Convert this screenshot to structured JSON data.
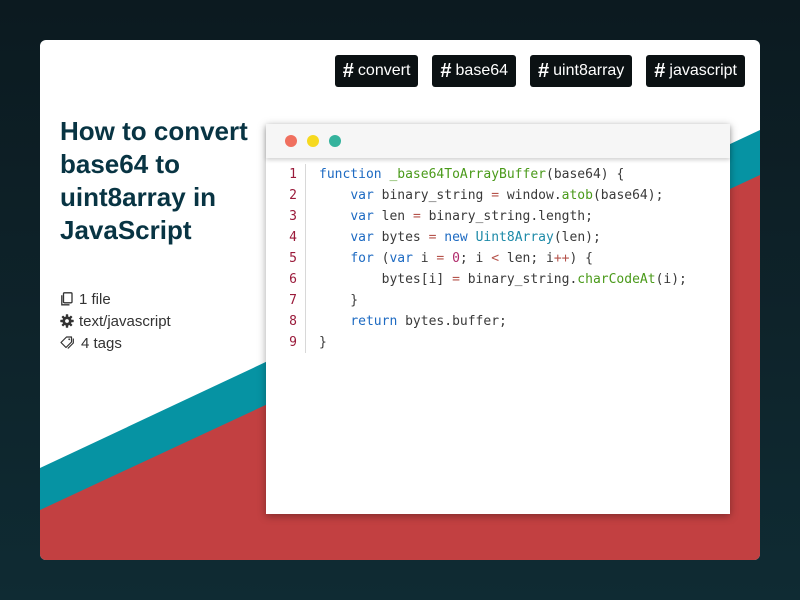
{
  "colors": {
    "background": "#0f2b33",
    "teal": "#0693a3",
    "red": "#c24041",
    "title": "#083443",
    "tag_bg": "#0b1113",
    "dot_red": "#f0705f",
    "dot_yellow": "#f6d91f",
    "dot_green": "#35b39d"
  },
  "tags": [
    {
      "label": "convert"
    },
    {
      "label": "base64"
    },
    {
      "label": "uint8array"
    },
    {
      "label": "javascript"
    }
  ],
  "title": "How to convert base64 to uint8array in JavaScript",
  "meta": {
    "files": "1 file",
    "language": "text/javascript",
    "tags_count": "4 tags",
    "icons": [
      "file-icon",
      "gear-icon",
      "tags-icon"
    ]
  },
  "code": {
    "lines": [
      {
        "n": "1",
        "tokens": [
          {
            "t": "function",
            "c": "kw"
          },
          {
            "t": " "
          },
          {
            "t": "_base64ToArrayBuffer",
            "c": "fn"
          },
          {
            "t": "(base64) {"
          }
        ]
      },
      {
        "n": "2",
        "tokens": [
          {
            "t": "    "
          },
          {
            "t": "var",
            "c": "kw"
          },
          {
            "t": " binary_string "
          },
          {
            "t": "=",
            "c": "op"
          },
          {
            "t": " window."
          },
          {
            "t": "atob",
            "c": "fn"
          },
          {
            "t": "(base64);"
          }
        ]
      },
      {
        "n": "3",
        "tokens": [
          {
            "t": "    "
          },
          {
            "t": "var",
            "c": "kw"
          },
          {
            "t": " len "
          },
          {
            "t": "=",
            "c": "op"
          },
          {
            "t": " binary_string.length;"
          }
        ]
      },
      {
        "n": "4",
        "tokens": [
          {
            "t": "    "
          },
          {
            "t": "var",
            "c": "kw"
          },
          {
            "t": " bytes "
          },
          {
            "t": "=",
            "c": "op"
          },
          {
            "t": " "
          },
          {
            "t": "new",
            "c": "kw"
          },
          {
            "t": " "
          },
          {
            "t": "Uint8Array",
            "c": "ty"
          },
          {
            "t": "(len);"
          }
        ]
      },
      {
        "n": "5",
        "tokens": [
          {
            "t": "    "
          },
          {
            "t": "for",
            "c": "kw"
          },
          {
            "t": " ("
          },
          {
            "t": "var",
            "c": "kw"
          },
          {
            "t": " i "
          },
          {
            "t": "=",
            "c": "op"
          },
          {
            "t": " "
          },
          {
            "t": "0",
            "c": "num"
          },
          {
            "t": "; i "
          },
          {
            "t": "<",
            "c": "op"
          },
          {
            "t": " len; i"
          },
          {
            "t": "++",
            "c": "op"
          },
          {
            "t": ") {"
          }
        ]
      },
      {
        "n": "6",
        "tokens": [
          {
            "t": "        bytes[i] "
          },
          {
            "t": "=",
            "c": "op"
          },
          {
            "t": " binary_string."
          },
          {
            "t": "charCodeAt",
            "c": "fn"
          },
          {
            "t": "(i);"
          }
        ]
      },
      {
        "n": "7",
        "tokens": [
          {
            "t": "    }"
          }
        ]
      },
      {
        "n": "8",
        "tokens": [
          {
            "t": "    "
          },
          {
            "t": "return",
            "c": "kw"
          },
          {
            "t": " bytes.buffer;"
          }
        ]
      },
      {
        "n": "9",
        "tokens": [
          {
            "t": "}"
          }
        ]
      }
    ]
  }
}
